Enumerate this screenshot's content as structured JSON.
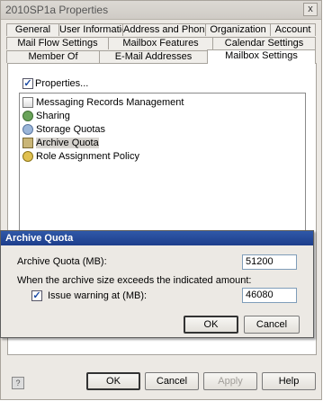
{
  "window": {
    "title": "2010SP1a Properties",
    "close_glyph": "x"
  },
  "tabs": {
    "row1": [
      "General",
      "User Information",
      "Address and Phone",
      "Organization",
      "Account"
    ],
    "row2": [
      "Mail Flow Settings",
      "Mailbox Features",
      "Calendar Settings"
    ],
    "row3": [
      "Member Of",
      "E-Mail Addresses",
      "Mailbox Settings"
    ],
    "active": "Mailbox Settings"
  },
  "mailbox_settings": {
    "properties_label": "Properties...",
    "items": [
      {
        "label": "Messaging Records Management",
        "icon": "records-icon"
      },
      {
        "label": "Sharing",
        "icon": "sharing-icon"
      },
      {
        "label": "Storage Quotas",
        "icon": "storage-quota-icon"
      },
      {
        "label": "Archive Quota",
        "icon": "archive-quota-icon",
        "selected": true
      },
      {
        "label": "Role Assignment Policy",
        "icon": "role-policy-icon"
      }
    ]
  },
  "archive_dialog": {
    "title": "Archive Quota",
    "quota_label": "Archive Quota (MB):",
    "quota_value": "51200",
    "exceed_label": "When the archive size exceeds the indicated amount:",
    "warning_label": "Issue warning at (MB):",
    "warning_checked": true,
    "warning_value": "46080",
    "ok_label": "OK",
    "cancel_label": "Cancel"
  },
  "footer": {
    "ok_label": "OK",
    "cancel_label": "Cancel",
    "apply_label": "Apply",
    "help_label": "Help"
  }
}
